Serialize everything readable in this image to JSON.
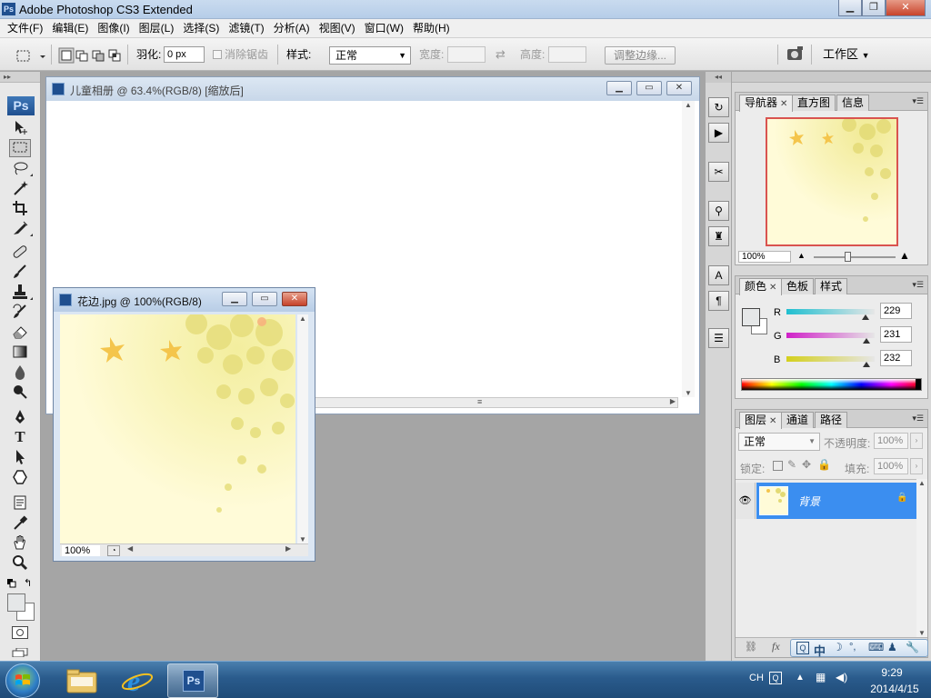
{
  "app": {
    "title": "Adobe Photoshop CS3 Extended"
  },
  "menu": [
    "文件(F)",
    "编辑(E)",
    "图像(I)",
    "图层(L)",
    "选择(S)",
    "滤镜(T)",
    "分析(A)",
    "视图(V)",
    "窗口(W)",
    "帮助(H)"
  ],
  "options": {
    "feather_label": "羽化:",
    "feather_value": "0 px",
    "antialias_label": "消除锯齿",
    "style_label": "样式:",
    "style_value": "正常",
    "width_label": "宽度:",
    "height_label": "高度:",
    "refine_edge_button": "调整边缘...",
    "workspace_label": "工作区"
  },
  "tools": {
    "badge": "Ps",
    "items": [
      "move",
      "rect-marquee",
      "lasso",
      "magic-wand",
      "crop",
      "slice",
      "healing-brush",
      "brush",
      "clone-stamp",
      "history-brush",
      "eraser",
      "gradient",
      "blur",
      "dodge",
      "pen",
      "type",
      "path-selection",
      "shape",
      "notes",
      "eyedropper",
      "hand",
      "zoom"
    ],
    "type_glyph": "T"
  },
  "documents": {
    "main": {
      "title": "儿童相册 @ 63.4%(RGB/8) [缩放后]"
    },
    "floral": {
      "title": "花边.jpg @ 100%(RGB/8)",
      "zoom": "100%"
    }
  },
  "navigator": {
    "tabs": [
      "导航器",
      "直方图",
      "信息"
    ],
    "zoom": "100%"
  },
  "color": {
    "tabs": [
      "颜色",
      "色板",
      "样式"
    ],
    "channels": [
      {
        "label": "R",
        "value": "229",
        "level": 229
      },
      {
        "label": "G",
        "value": "231",
        "level": 231
      },
      {
        "label": "B",
        "value": "232",
        "level": 232
      }
    ]
  },
  "layers": {
    "tabs": [
      "图层",
      "通道",
      "路径"
    ],
    "blend_mode": "正常",
    "opacity_label": "不透明度:",
    "opacity_value": "100%",
    "lock_label": "锁定:",
    "fill_label": "填充:",
    "fill_value": "100%",
    "layer_name": "背景"
  },
  "ime": {
    "chars": [
      "中",
      "°,"
    ]
  },
  "taskbar": {
    "lang": "CH",
    "time": "9:29",
    "date": "2014/4/15"
  }
}
